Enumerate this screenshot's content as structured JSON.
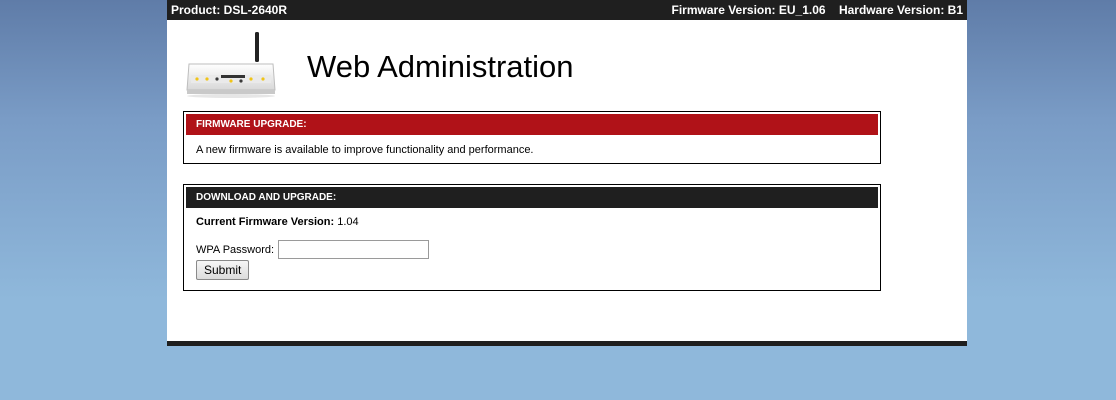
{
  "topbar": {
    "product": "Product: DSL-2640R",
    "firmware": "Firmware Version: EU_1.06",
    "hardware": "Hardware Version: B1"
  },
  "header": {
    "title": "Web Administration",
    "logo_icon": "router-icon"
  },
  "notice": {
    "heading": "FIRMWARE UPGRADE:",
    "message": "A new firmware is available to improve functionality and performance."
  },
  "upgrade": {
    "heading": "DOWNLOAD AND UPGRADE:",
    "current_label": "Current Firmware Version:",
    "current_value": "1.04",
    "password_label": "WPA Password:",
    "password_value": "",
    "submit_label": "Submit"
  },
  "colors": {
    "alert_bar": "#b01218",
    "dark_bar": "#1f1f1f"
  }
}
